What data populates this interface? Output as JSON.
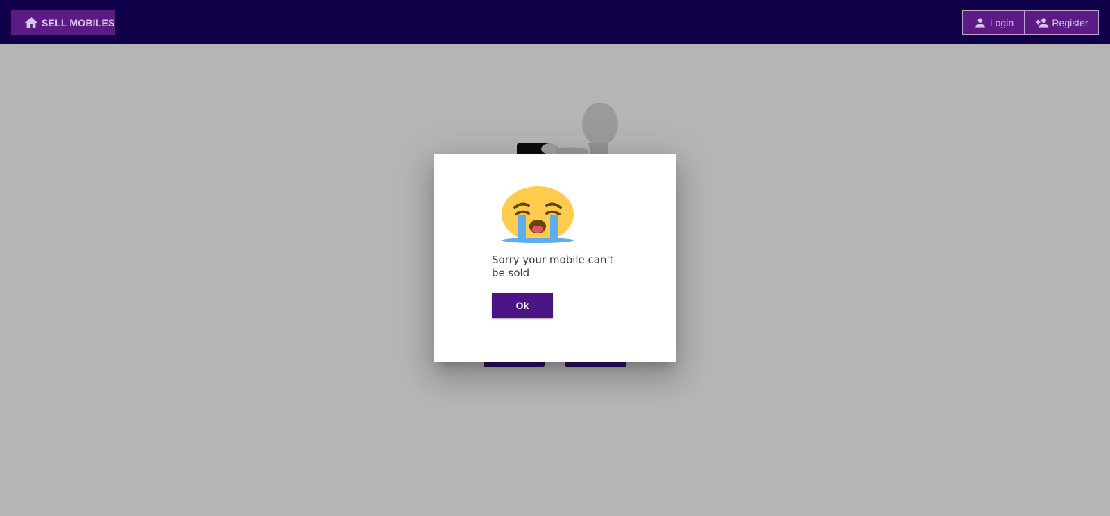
{
  "header": {
    "brand_label": "SELL MOBILES",
    "login_label": "Login",
    "register_label": "Register",
    "icons": {
      "brand": "home-icon",
      "login": "person-icon",
      "register": "person-add-icon"
    }
  },
  "dialog": {
    "icon": "loudly-crying-face-emoji",
    "message": "Sorry your mobile can't be sold",
    "ok_label": "Ok"
  },
  "colors": {
    "topbar": "#10004a",
    "nav_button": "#5c1a86",
    "primary_button": "#4a1487",
    "overlay": "rgba(0,0,0,0.29)"
  }
}
